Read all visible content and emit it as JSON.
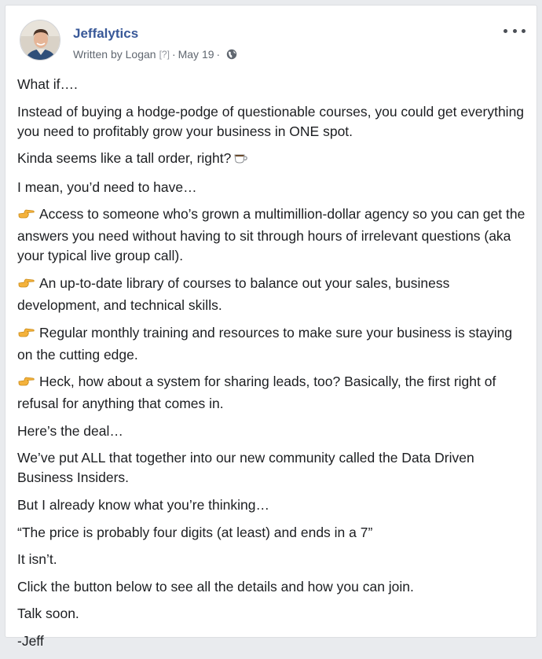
{
  "post": {
    "author": "Jeffalytics",
    "written_by": "Written by Logan",
    "help_mark": "[?]",
    "separator": "·",
    "date": "May 19",
    "more_icon": "more-dots-icon",
    "privacy_icon": "globe-icon",
    "paragraphs": [
      {
        "text": "What if….",
        "icon": ""
      },
      {
        "text": "Instead of buying a hodge-podge of questionable courses, you could get everything you need to profitably grow your business in ONE spot.",
        "icon": ""
      },
      {
        "text": "Kinda seems like a tall order, right?",
        "icon": "",
        "trail_icon": "coffee-cup-icon"
      },
      {
        "text": "I mean, you’d need to have…",
        "icon": ""
      },
      {
        "text": "Access to someone who’s grown a multimillion-dollar agency so you can get the answers you need without having to sit through hours of irrelevant questions (aka your typical live group call).",
        "icon": "pointing-hand-icon"
      },
      {
        "text": "An up-to-date library of courses to balance out your sales, business development, and technical skills.",
        "icon": "pointing-hand-icon"
      },
      {
        "text": "Regular monthly training and resources to make sure your business is staying on the cutting edge.",
        "icon": "pointing-hand-icon"
      },
      {
        "text": "Heck, how about a system for sharing leads, too? Basically, the first right of refusal for anything that comes in.",
        "icon": "pointing-hand-icon"
      },
      {
        "text": "Here’s the deal…",
        "icon": ""
      },
      {
        "text": "We’ve put ALL that together into our new community called the Data Driven Business Insiders.",
        "icon": ""
      },
      {
        "text": "But I already know what you’re thinking…",
        "icon": ""
      },
      {
        "text": "“The price is probably four digits (at least) and ends in a 7”",
        "icon": ""
      },
      {
        "text": "It isn’t.",
        "icon": ""
      },
      {
        "text": "Click the button below to see all the details and how you can join.",
        "icon": ""
      },
      {
        "text": "Talk soon.",
        "icon": ""
      },
      {
        "text": "-Jeff",
        "icon": ""
      }
    ]
  },
  "colors": {
    "link": "#385898",
    "meta": "#606770",
    "text": "#1c1e21",
    "emoji_hand": "#f4b23c"
  }
}
